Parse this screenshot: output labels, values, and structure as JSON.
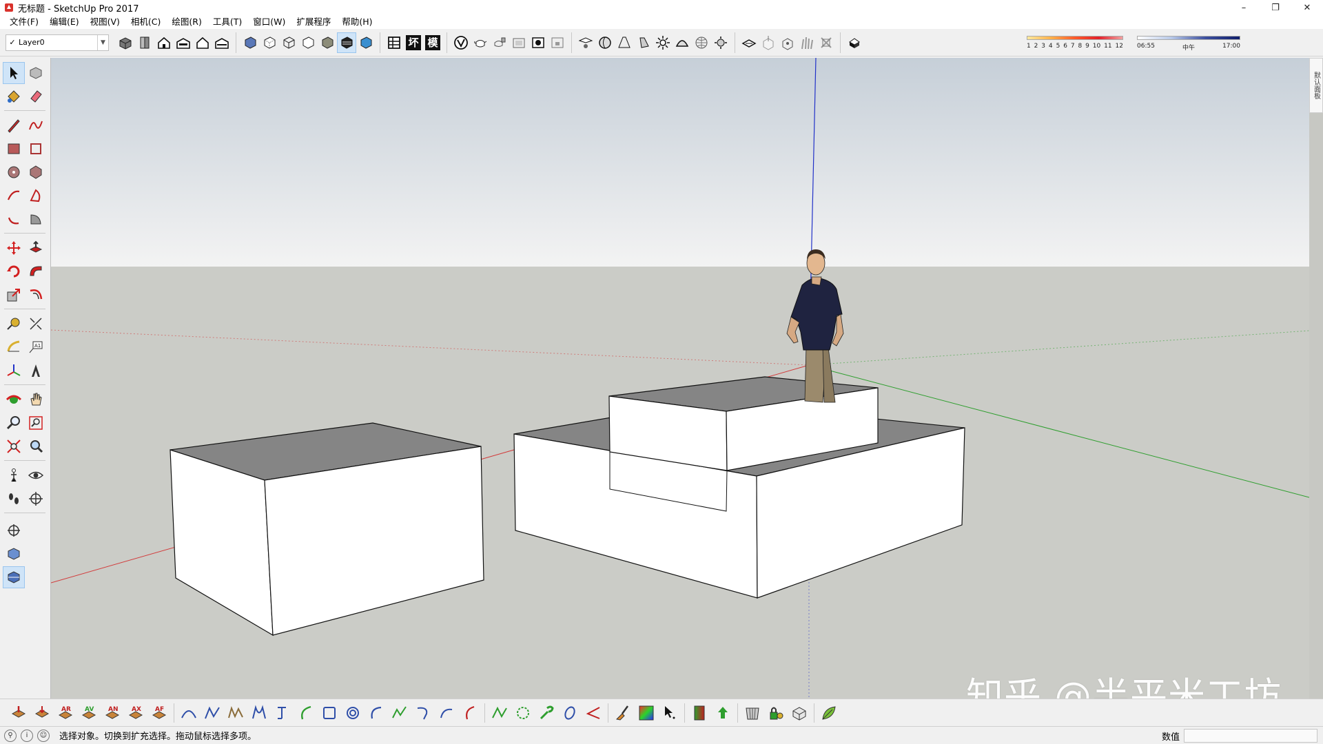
{
  "window": {
    "title": "无标题 - SketchUp Pro 2017",
    "controls": [
      "–",
      "❐",
      "✕"
    ]
  },
  "menu": [
    "文件(F)",
    "编辑(E)",
    "视图(V)",
    "相机(C)",
    "绘图(R)",
    "工具(T)",
    "窗口(W)",
    "扩展程序",
    "帮助(H)"
  ],
  "layer": {
    "check": "✓",
    "name": "Layer0"
  },
  "toolbar_text_buttons": [
    "坏",
    "模"
  ],
  "shadow": {
    "months": [
      "1",
      "2",
      "3",
      "4",
      "5",
      "6",
      "7",
      "8",
      "9",
      "10",
      "11",
      "12"
    ],
    "time_start": "06:55",
    "time_mid": "中午",
    "time_end": "17:00"
  },
  "tray": {
    "label": "默认面板"
  },
  "status": {
    "text": "选择对象。切换到扩充选择。拖动鼠标选择多项。",
    "measure_label": "数值",
    "measure_value": ""
  },
  "watermark": "知乎 @半平米工坊",
  "colors": {
    "sky_top": "#c8d0d8",
    "sky_bottom": "#f2f2f2",
    "ground": "#cbccc7",
    "axis_red": "#d23a3a",
    "axis_green": "#2e9e2e",
    "axis_blue": "#2030c8",
    "face_light": "#ffffff",
    "face_top": "#858585"
  }
}
